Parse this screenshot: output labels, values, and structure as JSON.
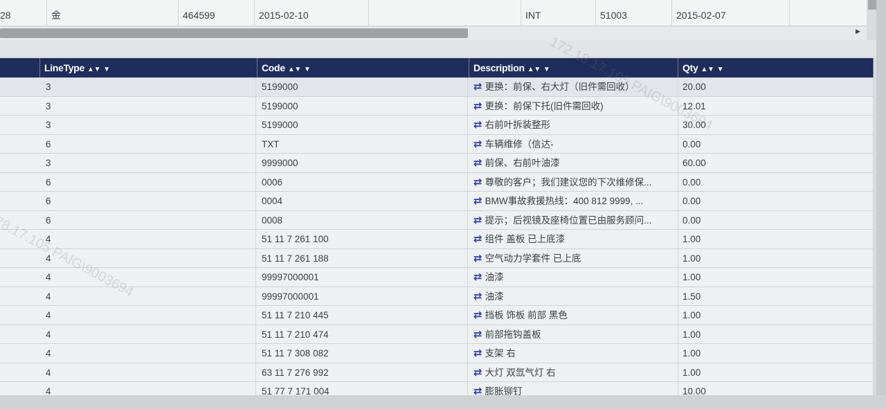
{
  "top_grid": {
    "row": [
      "28",
      "金",
      "464599",
      "2015-02-10",
      "",
      "INT",
      "51003",
      "2015-02-07"
    ]
  },
  "grid": {
    "columns": [
      {
        "label": "LineType"
      },
      {
        "label": "Code"
      },
      {
        "label": "Description"
      },
      {
        "label": "Qty"
      }
    ],
    "rows": [
      {
        "line_type": "3",
        "code": "5199000",
        "description": "更换：前保、右大灯（旧件需回收）",
        "qty": "20.00"
      },
      {
        "line_type": "3",
        "code": "5199000",
        "description": "更换：前保下托(旧件需回收)",
        "qty": "12.01"
      },
      {
        "line_type": "3",
        "code": "5199000",
        "description": "右前叶拆装整形",
        "qty": "30.00"
      },
      {
        "line_type": "6",
        "code": "TXT",
        "description": "车辆维修（信达-",
        "qty": "0.00"
      },
      {
        "line_type": "3",
        "code": "9999000",
        "description": "前保、右前叶油漆",
        "qty": "60.00"
      },
      {
        "line_type": "6",
        "code": "0006",
        "description": "尊敬的客户；我们建议您的下次维修保...",
        "qty": "0.00"
      },
      {
        "line_type": "6",
        "code": "0004",
        "description": "BMW事故救援热线：400 812 9999, ...",
        "qty": "0.00"
      },
      {
        "line_type": "6",
        "code": "0008",
        "description": "提示；后视镜及座椅位置已由服务顾问...",
        "qty": "0.00"
      },
      {
        "line_type": "4",
        "code": "51 11 7 261 100",
        "description": "组件 盖板 已上底漆",
        "qty": "1.00"
      },
      {
        "line_type": "4",
        "code": "51 11 7 261 188",
        "description": "空气动力学套件 已上底",
        "qty": "1.00"
      },
      {
        "line_type": "4",
        "code": "99997000001",
        "description": "油漆",
        "qty": "1.00"
      },
      {
        "line_type": "4",
        "code": "99997000001",
        "description": "油漆",
        "qty": "1.50"
      },
      {
        "line_type": "4",
        "code": "51 11 7 210 445",
        "description": "挡板 饰板 前部 黑色",
        "qty": "1.00"
      },
      {
        "line_type": "4",
        "code": "51 11 7 210 474",
        "description": "前部拖钩盖板",
        "qty": "1.00"
      },
      {
        "line_type": "4",
        "code": "51 11 7 308 082",
        "description": "支架 右",
        "qty": "1.00"
      },
      {
        "line_type": "4",
        "code": "63 11 7 276 992",
        "description": "大灯 双氙气灯 右",
        "qty": "1.00"
      },
      {
        "line_type": "4",
        "code": "51 77 7 171 004",
        "description": "膨胀铆钉",
        "qty": "10.00"
      }
    ]
  },
  "watermark": {
    "text_a": "172.18.17.105  PAIG\\9003694",
    "text_b": "78.17.105  PAIG\\9003694"
  },
  "colors": {
    "header_bg": "#1f2d5c",
    "swap_icon": "#2a3fa8"
  },
  "icons": {
    "sort": "sort-updown-icon",
    "filter": "filter-icon",
    "row_swap": "swap-arrows-icon"
  }
}
